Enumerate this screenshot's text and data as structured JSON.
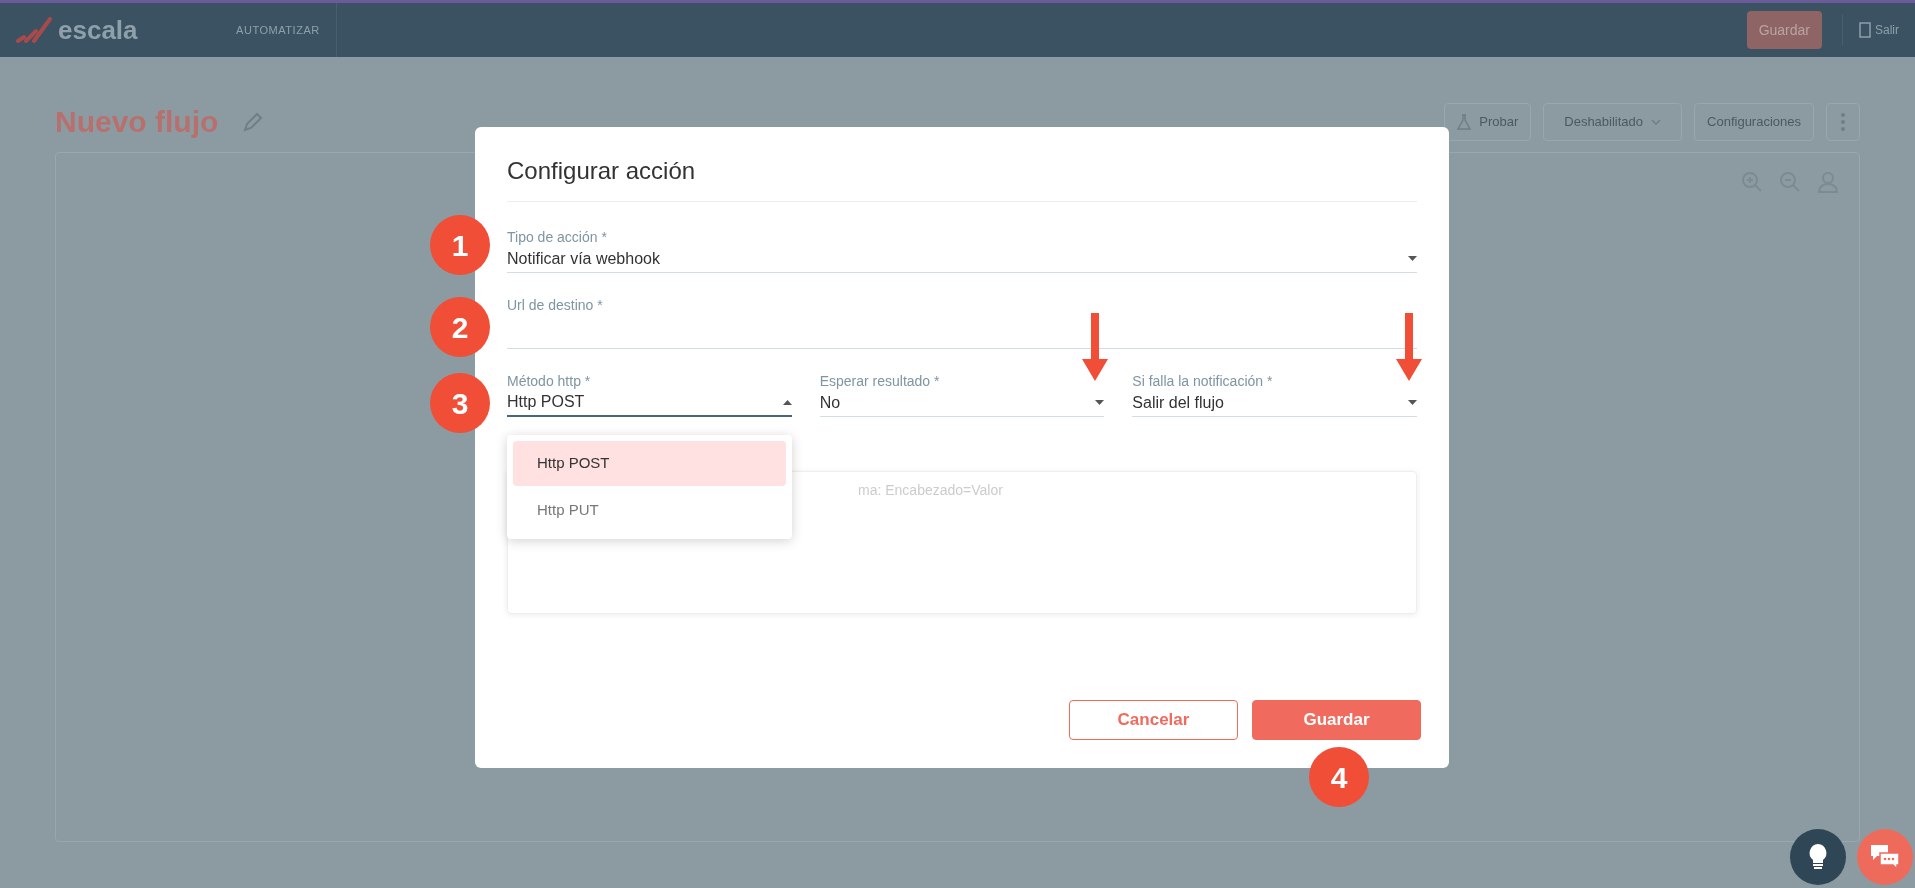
{
  "top_bar": {
    "logo_text": "escala",
    "section": "AUTOMATIZAR",
    "save_button": "Guardar",
    "exit_label": "Salir"
  },
  "page": {
    "title": "Nuevo flujo",
    "toolbar": [
      {
        "kind": "test",
        "label": "Probar"
      },
      {
        "kind": "dropdown",
        "label": "Deshabilitado"
      },
      {
        "kind": "plain",
        "label": "Configuraciones"
      },
      {
        "kind": "more"
      }
    ]
  },
  "modal": {
    "title": "Configurar acción",
    "fields": [
      {
        "kind": "select",
        "label": "Tipo de acción *",
        "value": "Notificar vía webhook",
        "expanded": false
      },
      {
        "kind": "text",
        "label": "Url de destino *"
      }
    ],
    "row_fields": [
      {
        "kind": "select",
        "label": "Método http *",
        "value": "Http POST",
        "expanded": true
      },
      {
        "kind": "select",
        "label": "Esperar resultado *",
        "value": "No",
        "expanded": false
      },
      {
        "kind": "select",
        "label": "Si falla la notificación *",
        "value": "Salir del flujo",
        "expanded": false
      }
    ],
    "menu_options": [
      {
        "label": "Http POST",
        "selected": true
      },
      {
        "label": "Http PUT",
        "selected": false
      }
    ],
    "headers_field": {
      "placeholder": "ma: Encabezado=Valor"
    },
    "buttons": [
      {
        "kind": "outline",
        "label": "Cancelar"
      },
      {
        "kind": "primary",
        "label": "Guardar"
      }
    ]
  },
  "markers": [
    {
      "number": "1"
    },
    {
      "number": "2"
    },
    {
      "number": "3"
    },
    {
      "number": "4"
    }
  ]
}
